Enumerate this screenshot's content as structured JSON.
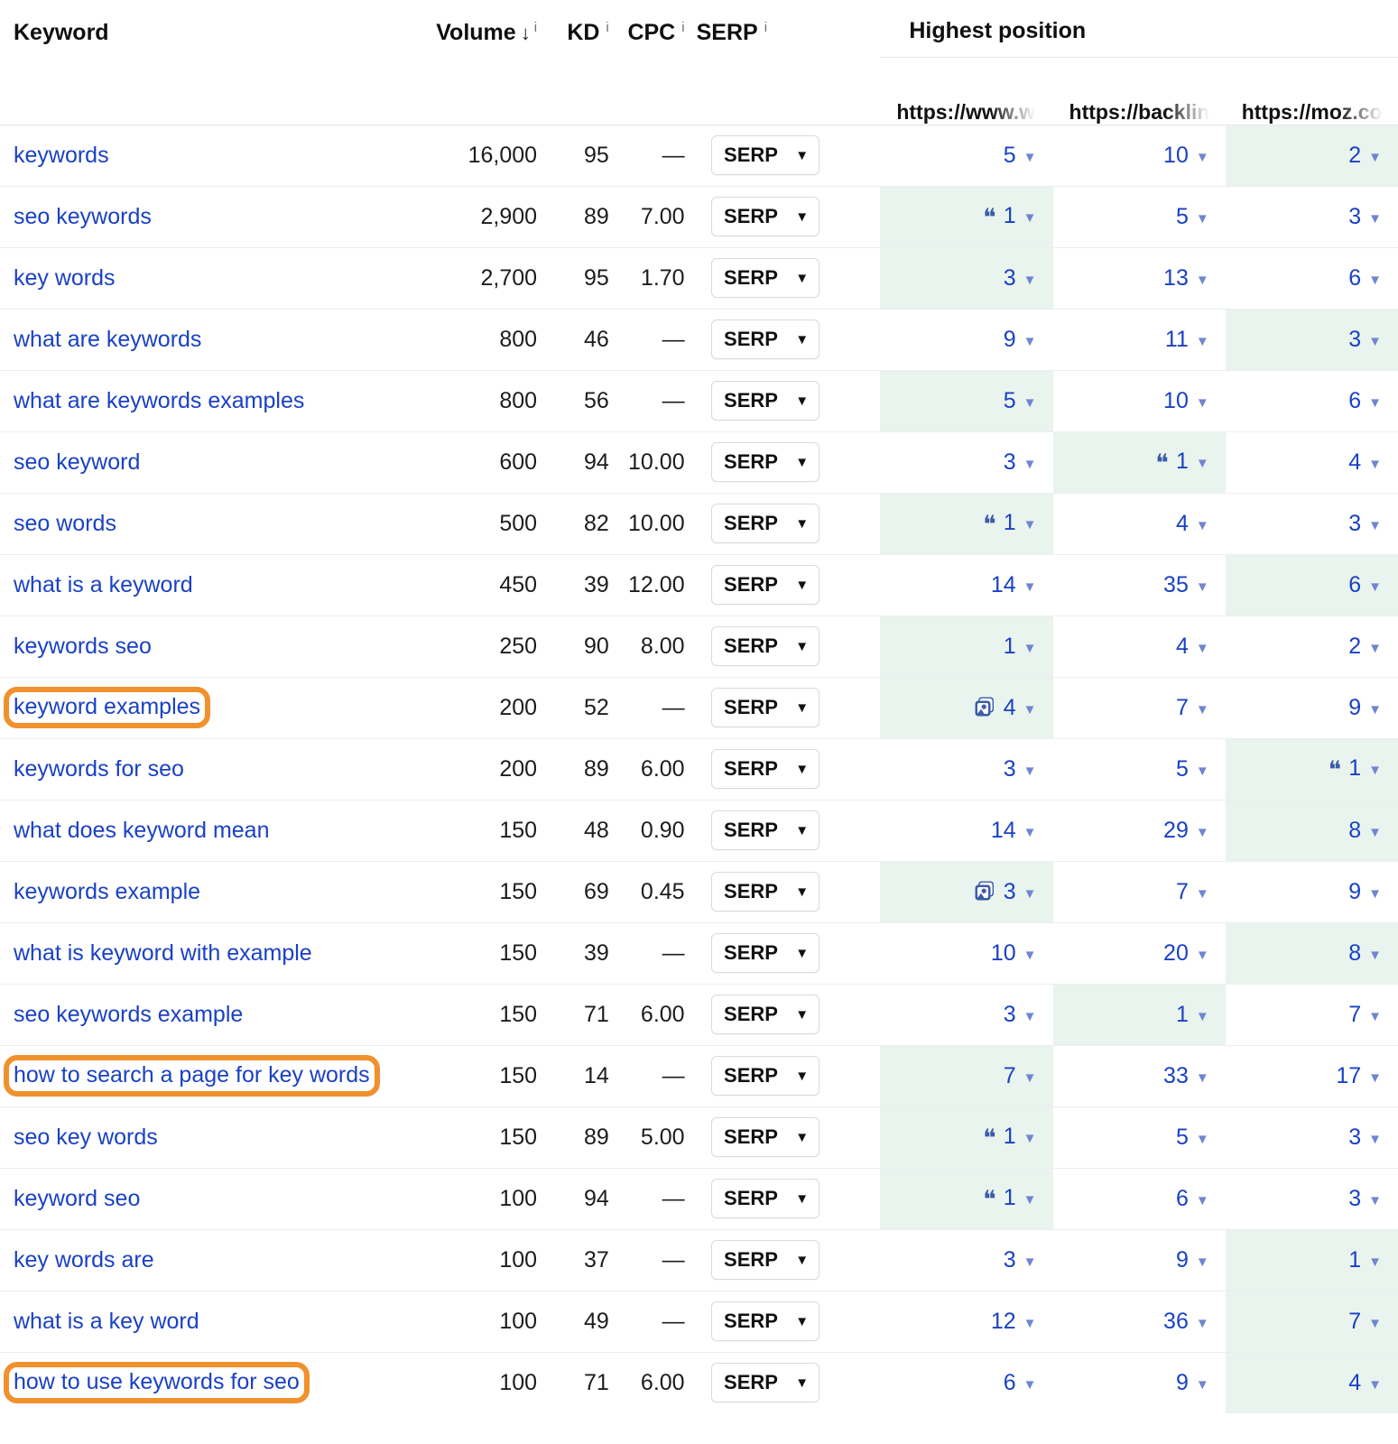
{
  "table": {
    "columns": {
      "keyword": "Keyword",
      "volume": "Volume",
      "kd": "KD",
      "cpc": "CPC",
      "serp": "SERP",
      "highest_position": "Highest position",
      "info_icon": "info-icon",
      "sort_arrow": "sort-descending-arrow"
    },
    "sites": [
      "https://www.w",
      "https://backlin",
      "https://moz.co"
    ],
    "serp_button_label": "SERP",
    "serp_button_caret": "▼",
    "position_caret": "▼",
    "featured_snippet_icon": "❝",
    "image_pack_icon": "image-pack-icon",
    "highlight_color": "#e9f4ee",
    "annotation_color": "#f0912d",
    "link_color": "#1a41c4",
    "rows": [
      {
        "keyword": "keywords",
        "highlighted": false,
        "volume": "16,000",
        "kd": "95",
        "cpc": "—",
        "positions": [
          {
            "value": "5",
            "best": false,
            "icon": ""
          },
          {
            "value": "10",
            "best": false,
            "icon": ""
          },
          {
            "value": "2",
            "best": true,
            "icon": ""
          }
        ]
      },
      {
        "keyword": "seo keywords",
        "highlighted": false,
        "volume": "2,900",
        "kd": "89",
        "cpc": "7.00",
        "positions": [
          {
            "value": "1",
            "best": true,
            "icon": "featured"
          },
          {
            "value": "5",
            "best": false,
            "icon": ""
          },
          {
            "value": "3",
            "best": false,
            "icon": ""
          }
        ]
      },
      {
        "keyword": "key words",
        "highlighted": false,
        "volume": "2,700",
        "kd": "95",
        "cpc": "1.70",
        "positions": [
          {
            "value": "3",
            "best": true,
            "icon": ""
          },
          {
            "value": "13",
            "best": false,
            "icon": ""
          },
          {
            "value": "6",
            "best": false,
            "icon": ""
          }
        ]
      },
      {
        "keyword": "what are keywords",
        "highlighted": false,
        "volume": "800",
        "kd": "46",
        "cpc": "—",
        "positions": [
          {
            "value": "9",
            "best": false,
            "icon": ""
          },
          {
            "value": "11",
            "best": false,
            "icon": ""
          },
          {
            "value": "3",
            "best": true,
            "icon": ""
          }
        ]
      },
      {
        "keyword": "what are keywords examples",
        "highlighted": false,
        "volume": "800",
        "kd": "56",
        "cpc": "—",
        "positions": [
          {
            "value": "5",
            "best": true,
            "icon": ""
          },
          {
            "value": "10",
            "best": false,
            "icon": ""
          },
          {
            "value": "6",
            "best": false,
            "icon": ""
          }
        ]
      },
      {
        "keyword": "seo keyword",
        "highlighted": false,
        "volume": "600",
        "kd": "94",
        "cpc": "10.00",
        "positions": [
          {
            "value": "3",
            "best": false,
            "icon": ""
          },
          {
            "value": "1",
            "best": true,
            "icon": "featured"
          },
          {
            "value": "4",
            "best": false,
            "icon": ""
          }
        ]
      },
      {
        "keyword": "seo words",
        "highlighted": false,
        "volume": "500",
        "kd": "82",
        "cpc": "10.00",
        "positions": [
          {
            "value": "1",
            "best": true,
            "icon": "featured"
          },
          {
            "value": "4",
            "best": false,
            "icon": ""
          },
          {
            "value": "3",
            "best": false,
            "icon": ""
          }
        ]
      },
      {
        "keyword": "what is a keyword",
        "highlighted": false,
        "volume": "450",
        "kd": "39",
        "cpc": "12.00",
        "positions": [
          {
            "value": "14",
            "best": false,
            "icon": ""
          },
          {
            "value": "35",
            "best": false,
            "icon": ""
          },
          {
            "value": "6",
            "best": true,
            "icon": ""
          }
        ]
      },
      {
        "keyword": "keywords seo",
        "highlighted": false,
        "volume": "250",
        "kd": "90",
        "cpc": "8.00",
        "positions": [
          {
            "value": "1",
            "best": true,
            "icon": ""
          },
          {
            "value": "4",
            "best": false,
            "icon": ""
          },
          {
            "value": "2",
            "best": false,
            "icon": ""
          }
        ]
      },
      {
        "keyword": "keyword examples",
        "highlighted": true,
        "volume": "200",
        "kd": "52",
        "cpc": "—",
        "positions": [
          {
            "value": "4",
            "best": true,
            "icon": "image"
          },
          {
            "value": "7",
            "best": false,
            "icon": ""
          },
          {
            "value": "9",
            "best": false,
            "icon": ""
          }
        ]
      },
      {
        "keyword": "keywords for seo",
        "highlighted": false,
        "volume": "200",
        "kd": "89",
        "cpc": "6.00",
        "positions": [
          {
            "value": "3",
            "best": false,
            "icon": ""
          },
          {
            "value": "5",
            "best": false,
            "icon": ""
          },
          {
            "value": "1",
            "best": true,
            "icon": "featured"
          }
        ]
      },
      {
        "keyword": "what does keyword mean",
        "highlighted": false,
        "volume": "150",
        "kd": "48",
        "cpc": "0.90",
        "positions": [
          {
            "value": "14",
            "best": false,
            "icon": ""
          },
          {
            "value": "29",
            "best": false,
            "icon": ""
          },
          {
            "value": "8",
            "best": true,
            "icon": ""
          }
        ]
      },
      {
        "keyword": "keywords example",
        "highlighted": false,
        "volume": "150",
        "kd": "69",
        "cpc": "0.45",
        "positions": [
          {
            "value": "3",
            "best": true,
            "icon": "image"
          },
          {
            "value": "7",
            "best": false,
            "icon": ""
          },
          {
            "value": "9",
            "best": false,
            "icon": ""
          }
        ]
      },
      {
        "keyword": "what is keyword with example",
        "highlighted": false,
        "volume": "150",
        "kd": "39",
        "cpc": "—",
        "positions": [
          {
            "value": "10",
            "best": false,
            "icon": ""
          },
          {
            "value": "20",
            "best": false,
            "icon": ""
          },
          {
            "value": "8",
            "best": true,
            "icon": ""
          }
        ]
      },
      {
        "keyword": "seo keywords example",
        "highlighted": false,
        "volume": "150",
        "kd": "71",
        "cpc": "6.00",
        "positions": [
          {
            "value": "3",
            "best": false,
            "icon": ""
          },
          {
            "value": "1",
            "best": true,
            "icon": ""
          },
          {
            "value": "7",
            "best": false,
            "icon": ""
          }
        ]
      },
      {
        "keyword": "how to search a page for key words",
        "highlighted": true,
        "volume": "150",
        "kd": "14",
        "cpc": "—",
        "positions": [
          {
            "value": "7",
            "best": true,
            "icon": ""
          },
          {
            "value": "33",
            "best": false,
            "icon": ""
          },
          {
            "value": "17",
            "best": false,
            "icon": ""
          }
        ]
      },
      {
        "keyword": "seo key words",
        "highlighted": false,
        "volume": "150",
        "kd": "89",
        "cpc": "5.00",
        "positions": [
          {
            "value": "1",
            "best": true,
            "icon": "featured"
          },
          {
            "value": "5",
            "best": false,
            "icon": ""
          },
          {
            "value": "3",
            "best": false,
            "icon": ""
          }
        ]
      },
      {
        "keyword": "keyword seo",
        "highlighted": false,
        "volume": "100",
        "kd": "94",
        "cpc": "—",
        "positions": [
          {
            "value": "1",
            "best": true,
            "icon": "featured"
          },
          {
            "value": "6",
            "best": false,
            "icon": ""
          },
          {
            "value": "3",
            "best": false,
            "icon": ""
          }
        ]
      },
      {
        "keyword": "key words are",
        "highlighted": false,
        "volume": "100",
        "kd": "37",
        "cpc": "—",
        "positions": [
          {
            "value": "3",
            "best": false,
            "icon": ""
          },
          {
            "value": "9",
            "best": false,
            "icon": ""
          },
          {
            "value": "1",
            "best": true,
            "icon": ""
          }
        ]
      },
      {
        "keyword": "what is a key word",
        "highlighted": false,
        "volume": "100",
        "kd": "49",
        "cpc": "—",
        "positions": [
          {
            "value": "12",
            "best": false,
            "icon": ""
          },
          {
            "value": "36",
            "best": false,
            "icon": ""
          },
          {
            "value": "7",
            "best": true,
            "icon": ""
          }
        ]
      },
      {
        "keyword": "how to use keywords for seo",
        "highlighted": true,
        "volume": "100",
        "kd": "71",
        "cpc": "6.00",
        "positions": [
          {
            "value": "6",
            "best": false,
            "icon": ""
          },
          {
            "value": "9",
            "best": false,
            "icon": ""
          },
          {
            "value": "4",
            "best": true,
            "icon": ""
          }
        ]
      }
    ]
  }
}
